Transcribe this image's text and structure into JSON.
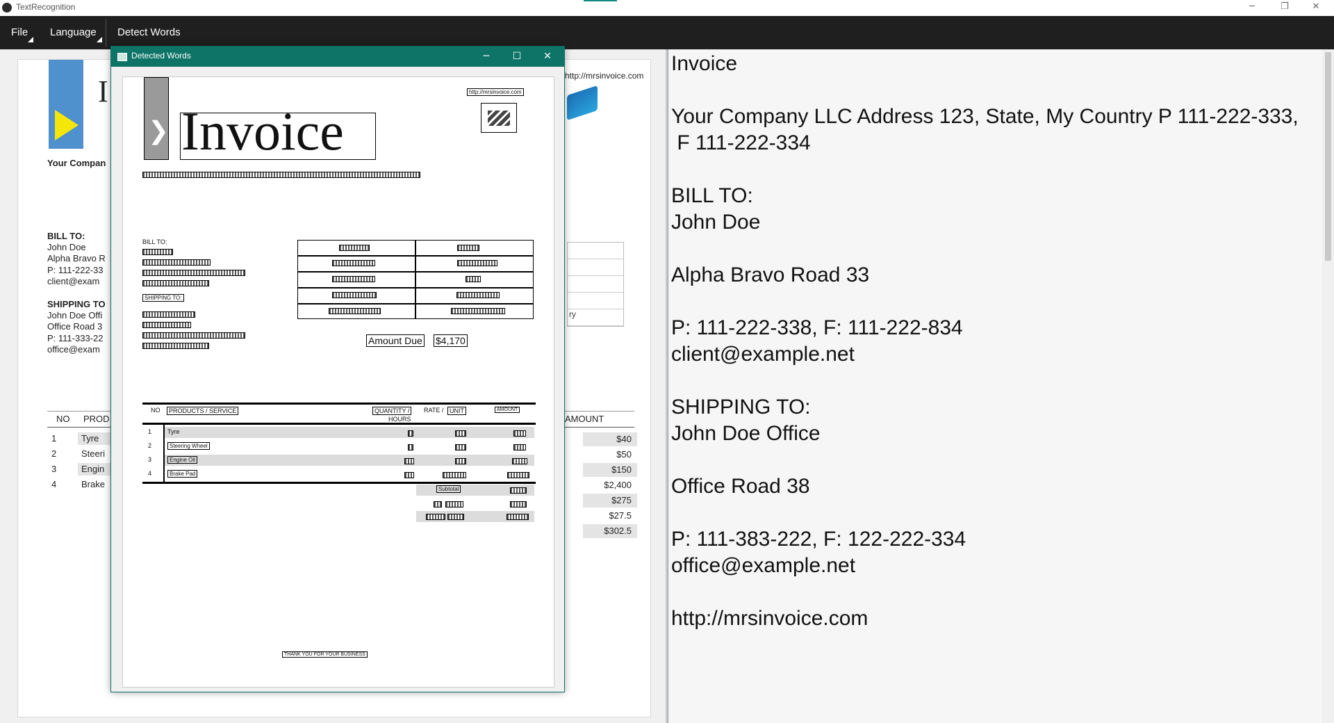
{
  "window": {
    "title": "TextRecognition",
    "minimize_glyph": "─",
    "maximize_glyph": "❐",
    "close_glyph": "✕"
  },
  "menu": {
    "file": "File",
    "language": "Language",
    "detect_words": "Detect Words"
  },
  "source_document": {
    "url": "http://mrsinvoice.com",
    "company_label": "Your Compan",
    "bill_to_label": "BILL TO:",
    "bill_lines": [
      "John Doe",
      "Alpha Bravo R",
      "P: 111-222-33",
      "client@exam"
    ],
    "shipping_label": "SHIPPING TO",
    "shipping_lines": [
      "John Doe Offi",
      "Office Road 3",
      "P: 111-333-22",
      "office@exam"
    ],
    "table_headers": {
      "no": "NO",
      "product": "PROD",
      "amount": "AMOUNT"
    },
    "items": [
      {
        "no": "1",
        "name": "Tyre",
        "amount": "$40"
      },
      {
        "no": "2",
        "name": "Steeri",
        "amount": "$50"
      },
      {
        "no": "3",
        "name": "Engin",
        "amount": "$150"
      },
      {
        "no": "4",
        "name": "Brake",
        "amount": "$2,400"
      }
    ],
    "totals": [
      "$275",
      "$27.5",
      "$302.5"
    ],
    "side_table_partial": "ry"
  },
  "dialog": {
    "title": "Detected Words",
    "minimize_glyph": "─",
    "maximize_glyph": "☐",
    "close_glyph": "✕",
    "invoice_heading": "Invoice",
    "url_small": "http://mrsinvoice.com",
    "bill_to": "BILL TO:",
    "shipping_to": "SHIPPING TO:",
    "amount_due": "Amount Due",
    "amount_value": "$4,170",
    "table_headers": {
      "no": "NO",
      "products": "PRODUCTS / SERVICE",
      "quantity": "QUANTITY /",
      "hours": "HOURS",
      "rate": "RATE /",
      "unit": "UNIT",
      "amount": "AMOUNT"
    },
    "rows": [
      {
        "no": "1",
        "name": "Tyre"
      },
      {
        "no": "2",
        "name": "Steering Wheel"
      },
      {
        "no": "3",
        "name": "Engine Oil"
      },
      {
        "no": "4",
        "name": "Brake Pad"
      }
    ],
    "subtotal": "Subtotal",
    "thanks": "THANK YOU FOR YOUR BUSINESS"
  },
  "ocr_output": "Invoice\n\nYour Company LLC Address 123, State, My Country P 111-222-333,\n F 111-222-334\n\nBILL TO:\nJohn Doe\n\nAlpha Bravo Road 33\n\nP: 111-222-338, F: 111-222-834\nclient@example.net\n\nSHIPPING TO:\nJohn Doe Office\n\nOffice Road 38\n\nP: 111-383-222, F: 122-222-334\noffice@example.net\n\nhttp://mrsinvoice.com"
}
